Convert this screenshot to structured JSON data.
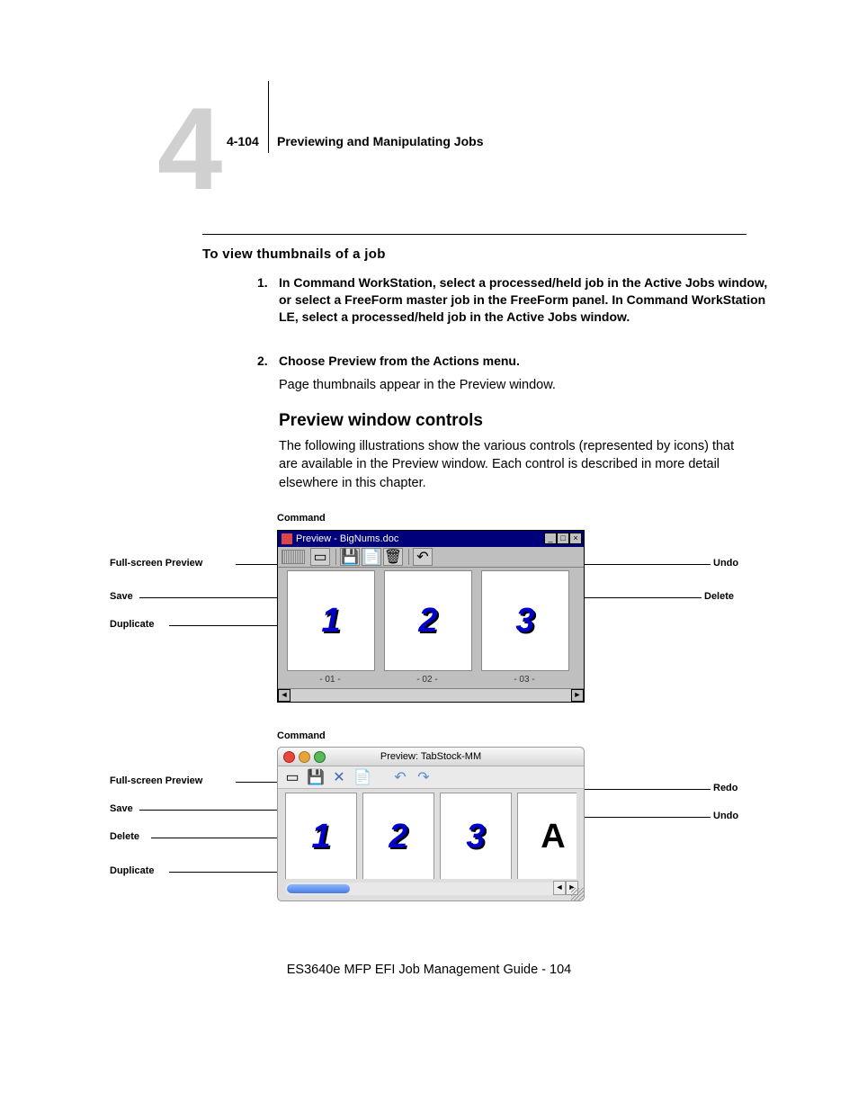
{
  "header": {
    "chapter_number": "4",
    "page_code": "4-104",
    "title": "Previewing and Manipulating Jobs"
  },
  "section_heading": "To view thumbnails of a job",
  "steps": [
    {
      "num": "1.",
      "text": "In Command WorkStation, select a processed/held job in the Active Jobs window, or select a FreeForm master job in the FreeForm panel. In Command WorkStation LE, select a processed/held job in the Active Jobs window."
    },
    {
      "num": "2.",
      "text": "Choose Preview from the Actions menu."
    }
  ],
  "step2_after": "Page thumbnails appear in the Preview window.",
  "h2": "Preview window controls",
  "h2_para": "The following illustrations show the various controls (represented by icons) that are available in the Preview window. Each control is described in more detail elsewhere in this chapter.",
  "group1": {
    "heading": "Command",
    "window_title": "Preview - BigNums.doc",
    "left_labels": [
      "Full-screen Preview",
      "Save",
      "Duplicate"
    ],
    "right_labels": [
      "Undo",
      "Delete"
    ],
    "thumbs": [
      {
        "n": "1",
        "caption": "- 01 -"
      },
      {
        "n": "2",
        "caption": "- 02 -"
      },
      {
        "n": "3",
        "caption": "- 03 -"
      }
    ]
  },
  "group2": {
    "heading": "Command",
    "window_title": "Preview: TabStock-MM",
    "left_labels": [
      "Full-screen Preview",
      "Save",
      "Delete",
      "Duplicate"
    ],
    "right_labels": [
      "Redo",
      "Undo"
    ],
    "thumbs": [
      "1",
      "2",
      "3",
      "A"
    ]
  },
  "footer": "ES3640e MFP EFI Job Management Guide - 104"
}
